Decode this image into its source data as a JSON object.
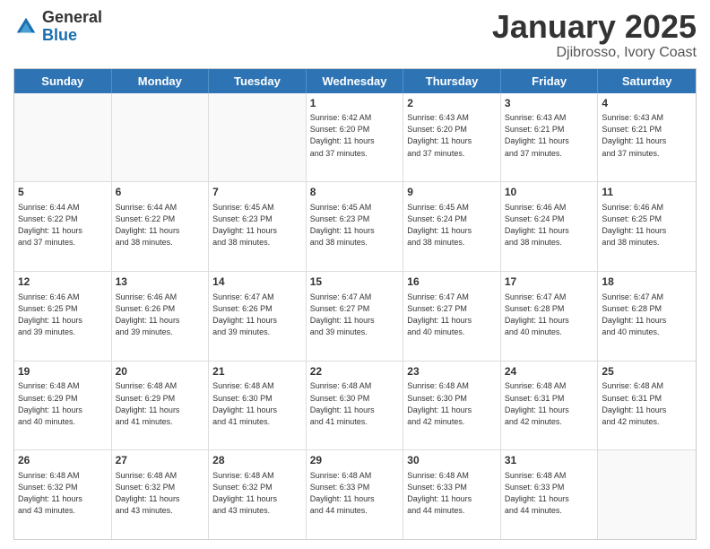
{
  "header": {
    "logo_general": "General",
    "logo_blue": "Blue",
    "title": "January 2025",
    "location": "Djibrosso, Ivory Coast"
  },
  "days_of_week": [
    "Sunday",
    "Monday",
    "Tuesday",
    "Wednesday",
    "Thursday",
    "Friday",
    "Saturday"
  ],
  "weeks": [
    [
      {
        "day": "",
        "info": ""
      },
      {
        "day": "",
        "info": ""
      },
      {
        "day": "",
        "info": ""
      },
      {
        "day": "1",
        "info": "Sunrise: 6:42 AM\nSunset: 6:20 PM\nDaylight: 11 hours\nand 37 minutes."
      },
      {
        "day": "2",
        "info": "Sunrise: 6:43 AM\nSunset: 6:20 PM\nDaylight: 11 hours\nand 37 minutes."
      },
      {
        "day": "3",
        "info": "Sunrise: 6:43 AM\nSunset: 6:21 PM\nDaylight: 11 hours\nand 37 minutes."
      },
      {
        "day": "4",
        "info": "Sunrise: 6:43 AM\nSunset: 6:21 PM\nDaylight: 11 hours\nand 37 minutes."
      }
    ],
    [
      {
        "day": "5",
        "info": "Sunrise: 6:44 AM\nSunset: 6:22 PM\nDaylight: 11 hours\nand 37 minutes."
      },
      {
        "day": "6",
        "info": "Sunrise: 6:44 AM\nSunset: 6:22 PM\nDaylight: 11 hours\nand 38 minutes."
      },
      {
        "day": "7",
        "info": "Sunrise: 6:45 AM\nSunset: 6:23 PM\nDaylight: 11 hours\nand 38 minutes."
      },
      {
        "day": "8",
        "info": "Sunrise: 6:45 AM\nSunset: 6:23 PM\nDaylight: 11 hours\nand 38 minutes."
      },
      {
        "day": "9",
        "info": "Sunrise: 6:45 AM\nSunset: 6:24 PM\nDaylight: 11 hours\nand 38 minutes."
      },
      {
        "day": "10",
        "info": "Sunrise: 6:46 AM\nSunset: 6:24 PM\nDaylight: 11 hours\nand 38 minutes."
      },
      {
        "day": "11",
        "info": "Sunrise: 6:46 AM\nSunset: 6:25 PM\nDaylight: 11 hours\nand 38 minutes."
      }
    ],
    [
      {
        "day": "12",
        "info": "Sunrise: 6:46 AM\nSunset: 6:25 PM\nDaylight: 11 hours\nand 39 minutes."
      },
      {
        "day": "13",
        "info": "Sunrise: 6:46 AM\nSunset: 6:26 PM\nDaylight: 11 hours\nand 39 minutes."
      },
      {
        "day": "14",
        "info": "Sunrise: 6:47 AM\nSunset: 6:26 PM\nDaylight: 11 hours\nand 39 minutes."
      },
      {
        "day": "15",
        "info": "Sunrise: 6:47 AM\nSunset: 6:27 PM\nDaylight: 11 hours\nand 39 minutes."
      },
      {
        "day": "16",
        "info": "Sunrise: 6:47 AM\nSunset: 6:27 PM\nDaylight: 11 hours\nand 40 minutes."
      },
      {
        "day": "17",
        "info": "Sunrise: 6:47 AM\nSunset: 6:28 PM\nDaylight: 11 hours\nand 40 minutes."
      },
      {
        "day": "18",
        "info": "Sunrise: 6:47 AM\nSunset: 6:28 PM\nDaylight: 11 hours\nand 40 minutes."
      }
    ],
    [
      {
        "day": "19",
        "info": "Sunrise: 6:48 AM\nSunset: 6:29 PM\nDaylight: 11 hours\nand 40 minutes."
      },
      {
        "day": "20",
        "info": "Sunrise: 6:48 AM\nSunset: 6:29 PM\nDaylight: 11 hours\nand 41 minutes."
      },
      {
        "day": "21",
        "info": "Sunrise: 6:48 AM\nSunset: 6:30 PM\nDaylight: 11 hours\nand 41 minutes."
      },
      {
        "day": "22",
        "info": "Sunrise: 6:48 AM\nSunset: 6:30 PM\nDaylight: 11 hours\nand 41 minutes."
      },
      {
        "day": "23",
        "info": "Sunrise: 6:48 AM\nSunset: 6:30 PM\nDaylight: 11 hours\nand 42 minutes."
      },
      {
        "day": "24",
        "info": "Sunrise: 6:48 AM\nSunset: 6:31 PM\nDaylight: 11 hours\nand 42 minutes."
      },
      {
        "day": "25",
        "info": "Sunrise: 6:48 AM\nSunset: 6:31 PM\nDaylight: 11 hours\nand 42 minutes."
      }
    ],
    [
      {
        "day": "26",
        "info": "Sunrise: 6:48 AM\nSunset: 6:32 PM\nDaylight: 11 hours\nand 43 minutes."
      },
      {
        "day": "27",
        "info": "Sunrise: 6:48 AM\nSunset: 6:32 PM\nDaylight: 11 hours\nand 43 minutes."
      },
      {
        "day": "28",
        "info": "Sunrise: 6:48 AM\nSunset: 6:32 PM\nDaylight: 11 hours\nand 43 minutes."
      },
      {
        "day": "29",
        "info": "Sunrise: 6:48 AM\nSunset: 6:33 PM\nDaylight: 11 hours\nand 44 minutes."
      },
      {
        "day": "30",
        "info": "Sunrise: 6:48 AM\nSunset: 6:33 PM\nDaylight: 11 hours\nand 44 minutes."
      },
      {
        "day": "31",
        "info": "Sunrise: 6:48 AM\nSunset: 6:33 PM\nDaylight: 11 hours\nand 44 minutes."
      },
      {
        "day": "",
        "info": ""
      }
    ]
  ]
}
